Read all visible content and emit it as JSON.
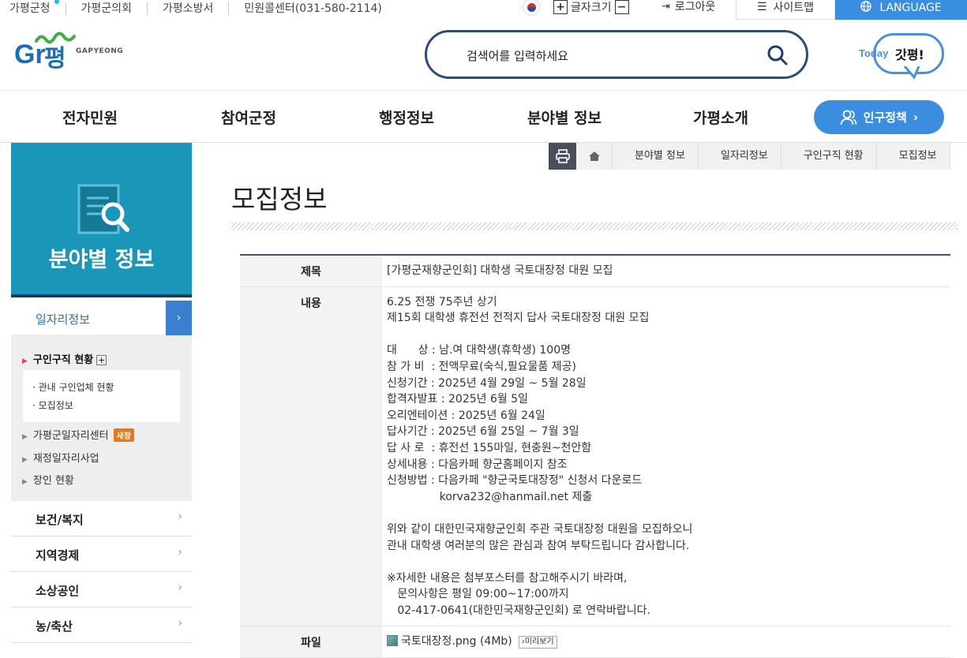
{
  "topbar": {
    "links": [
      "가평군청",
      "가평군의회",
      "가평소방서",
      "민원콜센터(031-580-2114)"
    ],
    "font_size_label": "글자크기",
    "logout": "로그아웃",
    "sitemap": "사이트맵",
    "language": "LANGUAGE"
  },
  "header": {
    "logo_en": "GAPYEONG",
    "search_placeholder": "검색어를 입력하세요",
    "today_label": "Today",
    "today_brand": "갓평!"
  },
  "nav": {
    "items": [
      "전자민원",
      "참여군정",
      "행정정보",
      "분야별 정보",
      "가평소개"
    ],
    "policy_button": "인구정책"
  },
  "sidebar": {
    "title": "분야별 정보",
    "current_section": "일자리정보",
    "menu": [
      {
        "label": "구인구직 현황",
        "active": true
      },
      {
        "label": "가평군일자리센터",
        "badge": "새창"
      },
      {
        "label": "재정일자리사업"
      },
      {
        "label": "장인 현황"
      }
    ],
    "submenu": [
      "관내 구인업체 현황",
      "모집정보"
    ],
    "sections": [
      "보건/복지",
      "지역경제",
      "소상공인",
      "농/축산"
    ]
  },
  "breadcrumb": [
    "분야별 정보",
    "일자리정보",
    "구인구직 현황",
    "모집정보"
  ],
  "page": {
    "title": "모집정보",
    "fields": {
      "subject_label": "제목",
      "subject": "[가평군재향군인회] 대학생 국토대장정 대원 모집",
      "content_label": "내용",
      "content_lines": [
        "6.25 전쟁 75주년 상기",
        "제15회 대학생 휴전선 전적지 답사 국토대장정 대원 모집",
        "",
        "대      상 : 남.여 대학생(휴학생) 100명",
        "참 가 비  : 전액무료(숙식,필요물품 제공)",
        "신청기간 : 2025년 4월 29일 ~ 5월 28일",
        "합격자발표 : 2025년 6월 5일",
        "오리엔테이션 : 2025년 6월 24일",
        "답사기간 : 2025년 6월 25일 ~ 7월 3일",
        "답 사 로  : 휴전선 155마일, 현충원~천안함",
        "상세내용 : 다음카페 향군홈페이지 참조",
        "신청방법 : 다음카페 \"향군국토대장정\" 신청서 다운로드",
        "               korva232@hanmail.net 제출",
        "",
        "위와 같이 대한민국재향군인회 주관 국토대장정 대원을 모집하오니",
        "관내 대학생 여러분의 많은 관심과 참여 부탁드립니다 감사합니다.",
        "",
        "※자세한 내용은 첨부포스터를 참고해주시기 바라며,",
        "   문의사항은 평일 09:00~17:00까지",
        "   02-417-0641(대한민국재향군인회) 로 연락바랍니다."
      ],
      "file_label": "파일",
      "file_name": "국토대장정.png (4Mb)",
      "preview": "미리보기"
    }
  }
}
